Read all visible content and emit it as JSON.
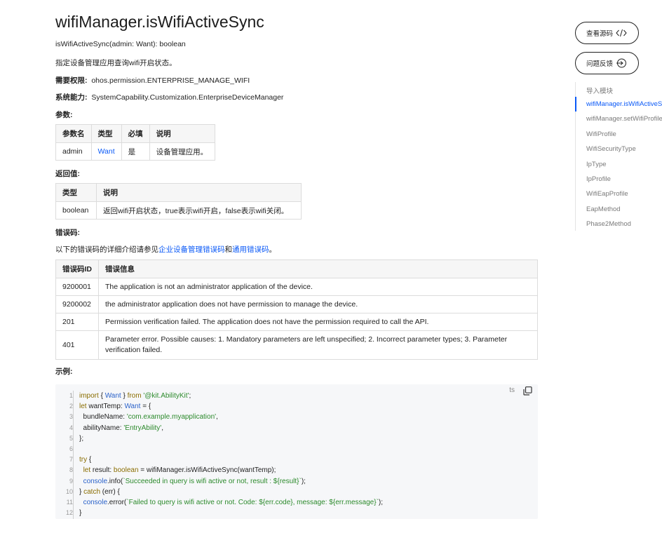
{
  "doc": {
    "title": "wifiManager.isWifiActiveSync",
    "signature": "isWifiActiveSync(admin: Want): boolean",
    "description": "指定设备管理应用查询wifi开启状态。",
    "permission_label": "需要权限:",
    "permission_value": "ohos.permission.ENTERPRISE_MANAGE_WIFI",
    "syscap_label": "系统能力:",
    "syscap_value": "SystemCapability.Customization.EnterpriseDeviceManager",
    "params_heading": "参数:",
    "params_table": {
      "headers": [
        "参数名",
        "类型",
        "必填",
        "说明"
      ],
      "rows": [
        [
          "admin",
          "Want",
          "是",
          "设备管理应用。"
        ]
      ]
    },
    "return_heading": "返回值:",
    "return_table": {
      "headers": [
        "类型",
        "说明"
      ],
      "rows": [
        [
          "boolean",
          "返回wifi开启状态，true表示wifi开启，false表示wifi关闭。"
        ]
      ]
    },
    "errors_heading": "错误码:",
    "errors_intro_prefix": "以下的错误码的详细介绍请参见",
    "errors_link1": "企业设备管理错误码",
    "errors_intro_and": "和",
    "errors_link2": "通用错误码",
    "errors_intro_suffix": "。",
    "errors_table": {
      "headers": [
        "错误码ID",
        "错误信息"
      ],
      "rows": [
        [
          "9200001",
          "The application is not an administrator application of the device."
        ],
        [
          "9200002",
          "the administrator application does not have permission to manage the device."
        ],
        [
          "201",
          "Permission verification failed. The application does not have the permission required to call the API."
        ],
        [
          "401",
          "Parameter error. Possible causes: 1. Mandatory parameters are left unspecified; 2. Incorrect parameter types; 3. Parameter verification failed."
        ]
      ]
    },
    "example_heading": "示例:"
  },
  "code": {
    "language": "ts",
    "line_numbers": [
      "1",
      "2",
      "3",
      "4",
      "5",
      "6",
      "7",
      "8",
      "9",
      "10",
      "11",
      "12"
    ],
    "lines": [
      "import { Want } from '@kit.AbilityKit';",
      "let wantTemp: Want = {",
      "  bundleName: 'com.example.myapplication',",
      "  abilityName: 'EntryAbility',",
      "};",
      "",
      "try {",
      "  let result: boolean = wifiManager.isWifiActiveSync(wantTemp);",
      "  console.info(`Succeeded in query is wifi active or not, result : ${result}`);",
      "} catch (err) {",
      "  console.error(`Failed to query is wifi active or not. Code: ${err.code}, message: ${err.message}`);",
      "}"
    ]
  },
  "sidebar": {
    "view_source": "查看源码",
    "feedback": "问题反馈",
    "toc": [
      "导入模块",
      "wifiManager.isWifiActiveSync",
      "wifiManager.setWifiProfileSync",
      "WifiProfile",
      "WifiSecurityType",
      "IpType",
      "IpProfile",
      "WifiEapProfile",
      "EapMethod",
      "Phase2Method"
    ],
    "active_index": 1
  },
  "colors": {
    "link": "#0a59f7",
    "text": "#191919",
    "muted": "#7a7a7a"
  }
}
